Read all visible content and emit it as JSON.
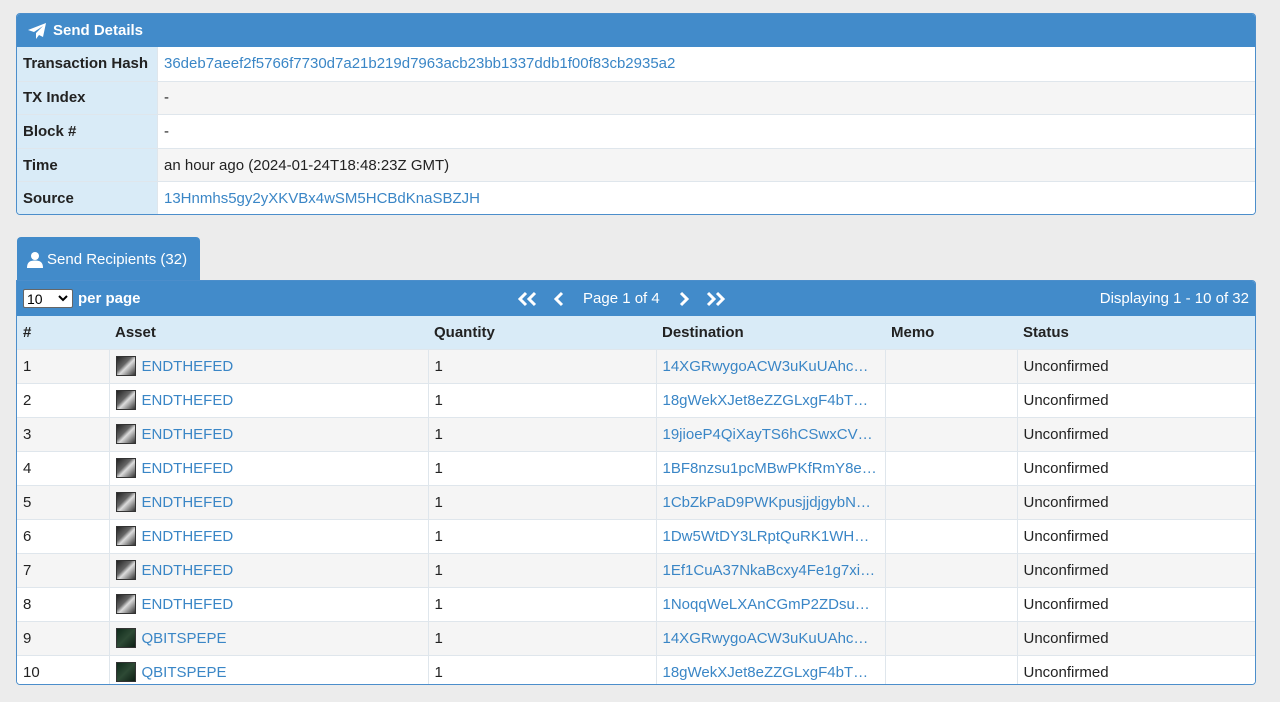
{
  "details": {
    "title": "Send Details",
    "rows": [
      {
        "label": "Transaction Hash",
        "value": "36deb7aeef2f5766f7730d7a21b219d7963acb23bb1337ddb1f00f83cb2935a2",
        "link": true
      },
      {
        "label": "TX Index",
        "value": "-",
        "link": false
      },
      {
        "label": "Block #",
        "value": "-",
        "link": false
      },
      {
        "label": "Time",
        "value": "an hour ago (2024-01-24T18:48:23Z GMT)",
        "link": false
      },
      {
        "label": "Source",
        "value": "13Hnmhs5gy2yXKVBx4wSM5HCBdKnaSBZJH",
        "link": true
      }
    ]
  },
  "recipients": {
    "tab_label": "Send Recipients (32)",
    "per_page_value": "10",
    "per_page_label": "per page",
    "page_label": "Page 1 of 4",
    "displaying": "Displaying 1 - 10 of 32",
    "columns": [
      "#",
      "Asset",
      "Quantity",
      "Destination",
      "Memo",
      "Status"
    ],
    "rows": [
      {
        "n": "1",
        "asset": "ENDTHEFED",
        "icon": "fed",
        "qty": "1",
        "dest": "14XGRwygoACW3uKuUAhc…",
        "memo": "",
        "status": "Unconfirmed"
      },
      {
        "n": "2",
        "asset": "ENDTHEFED",
        "icon": "fed",
        "qty": "1",
        "dest": "18gWekXJet8eZZGLxgF4bT…",
        "memo": "",
        "status": "Unconfirmed"
      },
      {
        "n": "3",
        "asset": "ENDTHEFED",
        "icon": "fed",
        "qty": "1",
        "dest": "19jioeP4QiXayTS6hCSwxCV…",
        "memo": "",
        "status": "Unconfirmed"
      },
      {
        "n": "4",
        "asset": "ENDTHEFED",
        "icon": "fed",
        "qty": "1",
        "dest": "1BF8nzsu1pcMBwPKfRmY8e…",
        "memo": "",
        "status": "Unconfirmed"
      },
      {
        "n": "5",
        "asset": "ENDTHEFED",
        "icon": "fed",
        "qty": "1",
        "dest": "1CbZkPaD9PWKpusjjdjgybN…",
        "memo": "",
        "status": "Unconfirmed"
      },
      {
        "n": "6",
        "asset": "ENDTHEFED",
        "icon": "fed",
        "qty": "1",
        "dest": "1Dw5WtDY3LRptQuRK1WH…",
        "memo": "",
        "status": "Unconfirmed"
      },
      {
        "n": "7",
        "asset": "ENDTHEFED",
        "icon": "fed",
        "qty": "1",
        "dest": "1Ef1CuA37NkaBcxy4Fe1g7xi…",
        "memo": "",
        "status": "Unconfirmed"
      },
      {
        "n": "8",
        "asset": "ENDTHEFED",
        "icon": "fed",
        "qty": "1",
        "dest": "1NoqqWeLXAnCGmP2ZDsu…",
        "memo": "",
        "status": "Unconfirmed"
      },
      {
        "n": "9",
        "asset": "QBITSPEPE",
        "icon": "pepe",
        "qty": "1",
        "dest": "14XGRwygoACW3uKuUAhc…",
        "memo": "",
        "status": "Unconfirmed"
      },
      {
        "n": "10",
        "asset": "QBITSPEPE",
        "icon": "pepe",
        "qty": "1",
        "dest": "18gWekXJet8eZZGLxgF4bT…",
        "memo": "",
        "status": "Unconfirmed"
      }
    ]
  },
  "icons": {
    "details_header": "paper-plane-icon",
    "tab": "user-icon",
    "first_page": "double-chevron-left-icon",
    "prev_page": "chevron-left-icon",
    "next_page": "chevron-right-icon",
    "last_page": "double-chevron-right-icon"
  },
  "colors": {
    "header_blue": "#428bca",
    "label_bg": "#d9ebf7",
    "link": "#3a86c6"
  }
}
